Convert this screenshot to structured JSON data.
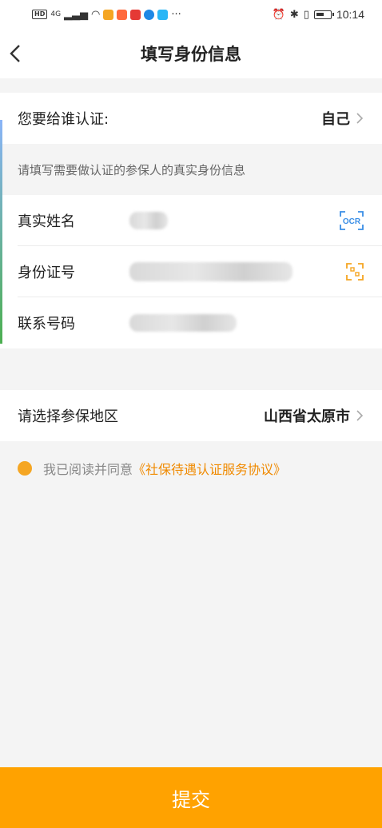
{
  "status_bar": {
    "time": "10:14",
    "network": "4G",
    "hd": "HD"
  },
  "nav": {
    "title": "填写身份信息"
  },
  "certify_for": {
    "label": "您要给谁认证:",
    "value": "自己"
  },
  "hint": "请填写需要做认证的参保人的真实身份信息",
  "form": {
    "name_label": "真实姓名",
    "ocr_label": "OCR",
    "id_label": "身份证号",
    "phone_label": "联系号码"
  },
  "region": {
    "label": "请选择参保地区",
    "value": "山西省太原市"
  },
  "agreement": {
    "text": "我已阅读并同意",
    "link": "《社保待遇认证服务协议》"
  },
  "submit_label": "提交",
  "colors": {
    "accent": "#ffa200",
    "link": "#f08a00",
    "ocr_blue": "#3a8ee6"
  }
}
